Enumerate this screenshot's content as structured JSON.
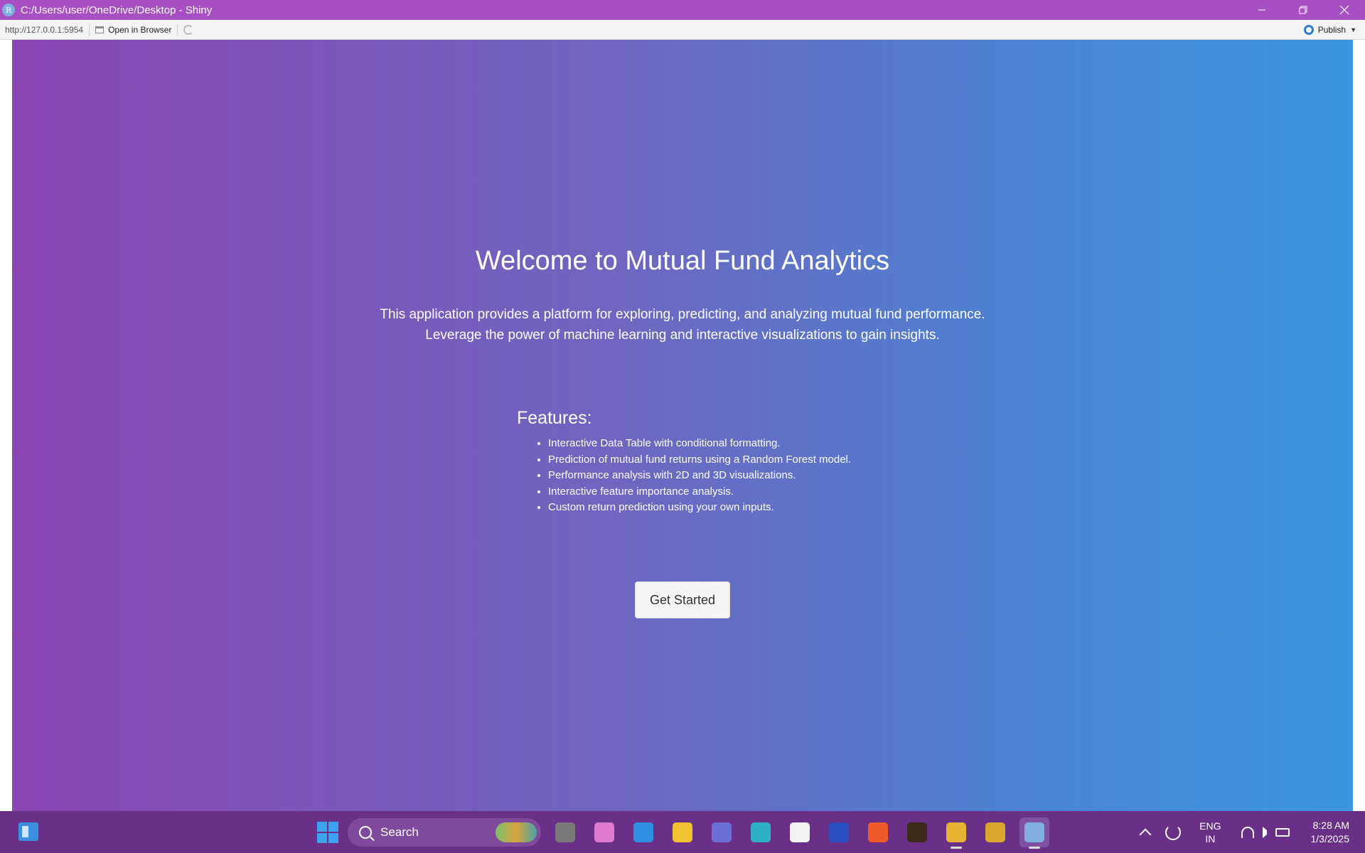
{
  "window": {
    "title": "C:/Users/user/OneDrive/Desktop - Shiny",
    "app_icon_letter": "R"
  },
  "toolbar": {
    "url": "http://127.0.0.1:5954",
    "open_in_browser": "Open in Browser",
    "publish": "Publish"
  },
  "page": {
    "title": "Welcome to Mutual Fund Analytics",
    "description_line1": "This application provides a platform for exploring, predicting, and analyzing mutual fund performance.",
    "description_line2": "Leverage the power of machine learning and interactive visualizations to gain insights.",
    "features_heading": "Features:",
    "features": [
      "Interactive Data Table with conditional formatting.",
      "Prediction of mutual fund returns using a Random Forest model.",
      "Performance analysis with 2D and 3D visualizations.",
      "Interactive feature importance analysis.",
      "Custom return prediction using your own inputs."
    ],
    "cta_label": "Get Started"
  },
  "taskbar": {
    "search_label": "Search",
    "apps": [
      {
        "name": "task-view",
        "color": "#7a7a7a"
      },
      {
        "name": "copilot",
        "color": "#e07ad0"
      },
      {
        "name": "vscode",
        "color": "#2f8fe0"
      },
      {
        "name": "file-explorer",
        "color": "#f2c232"
      },
      {
        "name": "teams",
        "color": "#6b6fd6"
      },
      {
        "name": "edge",
        "color": "#2fb0c9"
      },
      {
        "name": "microsoft-store",
        "color": "#f3f3f3"
      },
      {
        "name": "app-mm",
        "color": "#2a4fc0"
      },
      {
        "name": "brave",
        "color": "#f05a2a"
      },
      {
        "name": "apna-college",
        "color": "#3a2a1a"
      },
      {
        "name": "chrome",
        "color": "#e6b432"
      },
      {
        "name": "git-gui",
        "color": "#d9a62e"
      },
      {
        "name": "r-shiny",
        "color": "#7fb0e0"
      }
    ],
    "lang_line1": "ENG",
    "lang_line2": "IN",
    "time": "8:28 AM",
    "date": "1/3/2025"
  }
}
